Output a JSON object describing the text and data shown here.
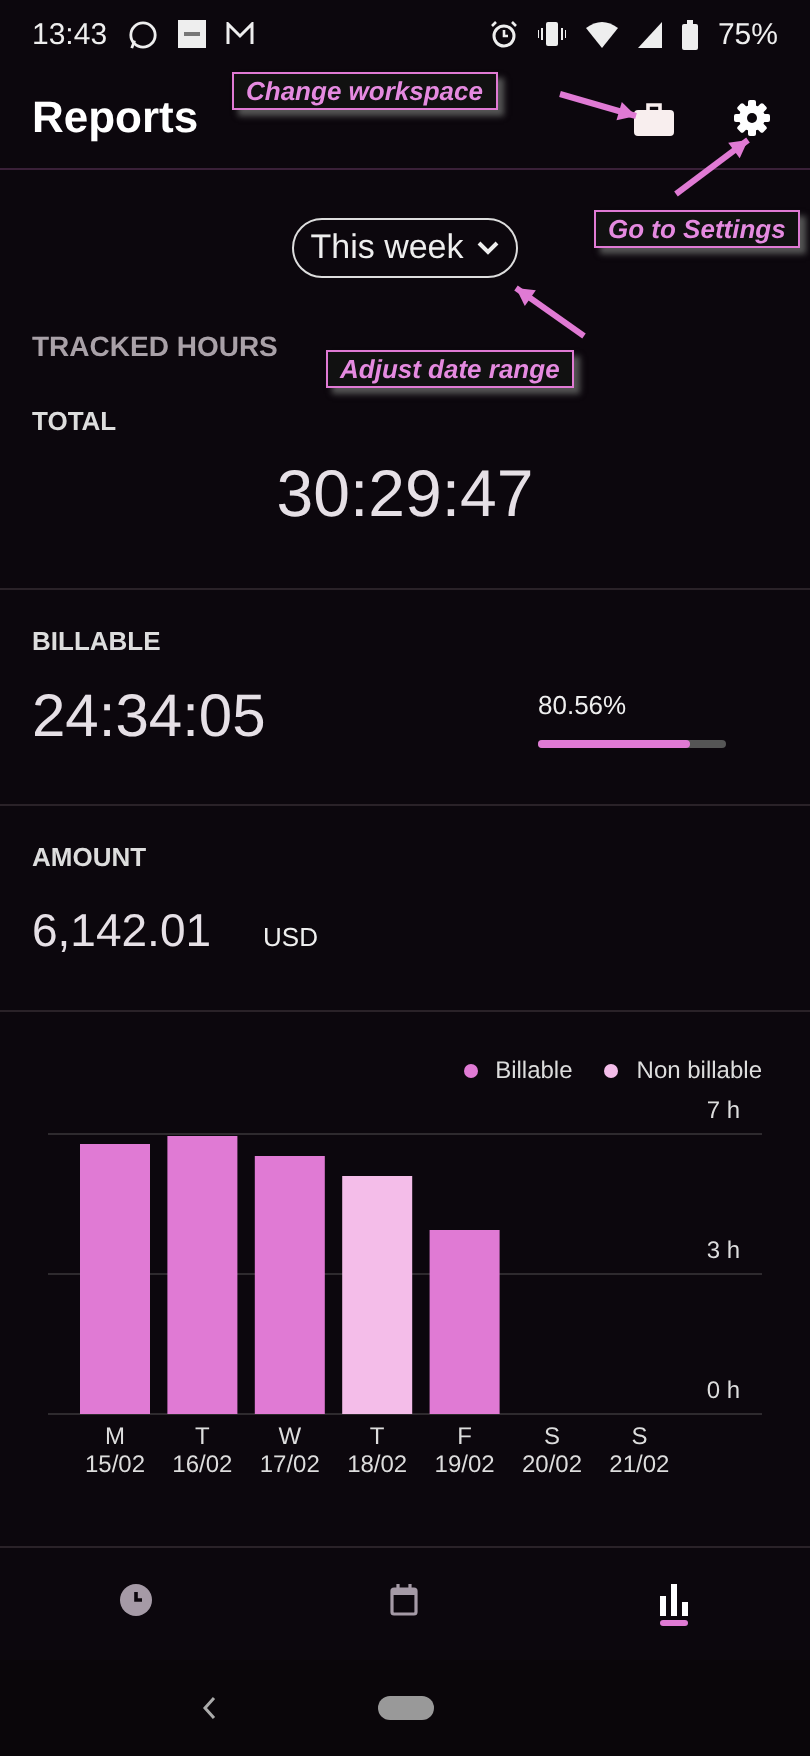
{
  "status_bar": {
    "time": "13:43",
    "battery": "75%"
  },
  "header": {
    "title": "Reports"
  },
  "annotations": [
    {
      "text": "Change workspace"
    },
    {
      "text": "Go to Settings"
    },
    {
      "text": "Adjust date range"
    }
  ],
  "date_range": {
    "label": "This week"
  },
  "section_title": "TRACKED HOURS",
  "total": {
    "label": "TOTAL",
    "value": "30:29:47"
  },
  "billable": {
    "label": "BILLABLE",
    "value": "24:34:05",
    "percent": "80.56%",
    "level": 0.8056
  },
  "amount": {
    "label": "AMOUNT",
    "value": "6,142.01",
    "currency": "USD"
  },
  "chart": {
    "chart_data": {
      "type": "bar",
      "stacked": true,
      "categories": [
        "M 15/02",
        "T 16/02",
        "W 17/02",
        "T 18/02",
        "F 19/02",
        "S 20/02",
        "S 21/02"
      ],
      "series": [
        {
          "name": "Billable",
          "color": "#e07ad4",
          "values": [
            6.75,
            6.95,
            6.45,
            null,
            4.6,
            null,
            null
          ]
        },
        {
          "name": "Non billable",
          "color": "#f4bde9",
          "values": [
            null,
            null,
            null,
            5.95,
            null,
            null,
            null
          ]
        }
      ],
      "ylim": [
        0,
        7
      ],
      "yticks": [
        {
          "value": 0,
          "label": "0 h"
        },
        {
          "value": 3.5,
          "label": "3 h"
        },
        {
          "value": 7,
          "label": "7 h"
        }
      ]
    }
  },
  "bottom_nav": [
    {
      "kind": "clock",
      "selected": false
    },
    {
      "kind": "calendar",
      "selected": false
    },
    {
      "kind": "chart",
      "selected": true
    }
  ]
}
